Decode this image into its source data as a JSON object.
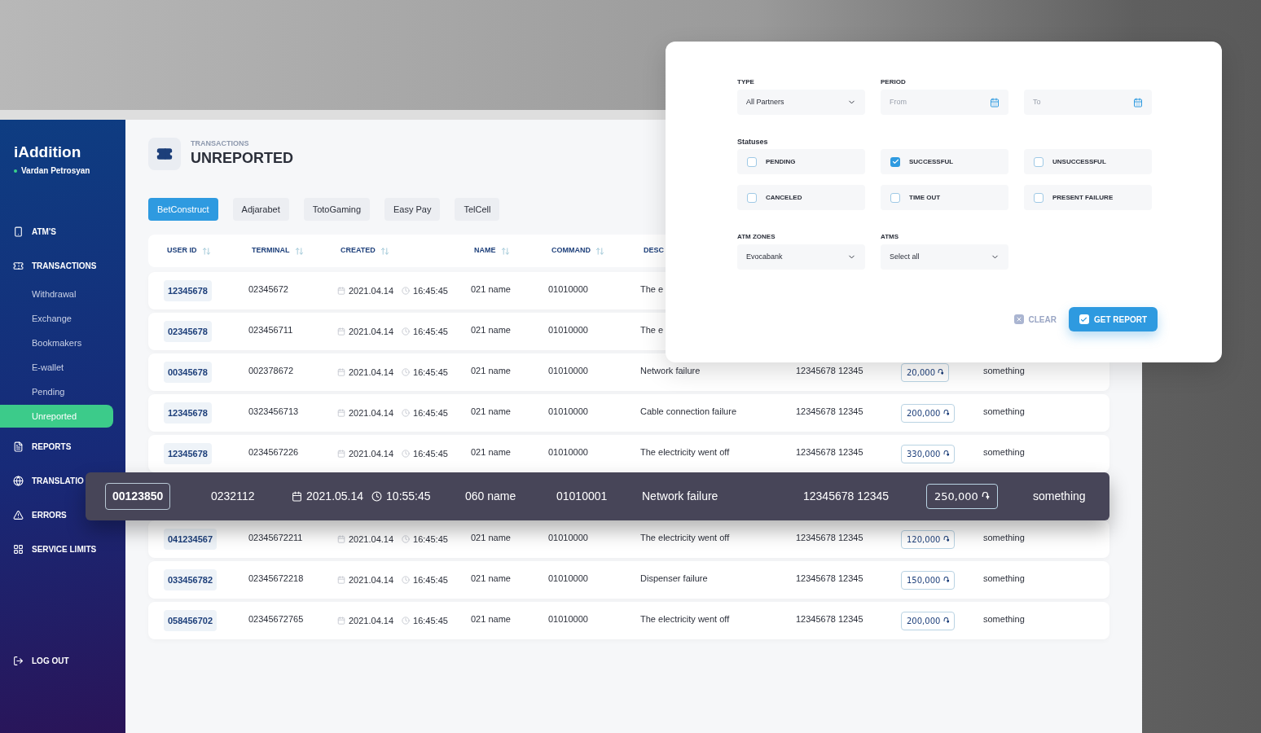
{
  "sidebar": {
    "brand": "iAddition",
    "user": "Vardan Petrosyan",
    "online": true,
    "nav": [
      {
        "label": "ATM'S"
      },
      {
        "label": "TRANSACTIONS",
        "children": [
          {
            "label": "Withdrawal",
            "selected": false
          },
          {
            "label": "Exchange",
            "selected": false
          },
          {
            "label": "Bookmakers",
            "selected": false
          },
          {
            "label": "E-wallet",
            "selected": false
          },
          {
            "label": "Pending",
            "selected": false
          },
          {
            "label": "Unreported",
            "selected": true
          }
        ]
      },
      {
        "label": "REPORTS"
      },
      {
        "label": "TRANSLATIO"
      },
      {
        "label": "ERRORS"
      },
      {
        "label": "SERVICE LIMITS"
      }
    ],
    "logout": "LOG OUT"
  },
  "header": {
    "section": "TRANSACTIONS",
    "title": "UNREPORTED"
  },
  "tabs": [
    {
      "label": "BetConstruct",
      "selected": true
    },
    {
      "label": "Adjarabet",
      "selected": false
    },
    {
      "label": "TotoGaming",
      "selected": false
    },
    {
      "label": "Easy Pay",
      "selected": false
    },
    {
      "label": "TelCell",
      "selected": false
    }
  ],
  "table": {
    "columns": [
      "USER ID",
      "TERMINAL",
      "CREATED",
      "NAME",
      "COMMAND",
      "DESC"
    ],
    "rows": [
      {
        "user_id": "12345678",
        "terminal": "02345672",
        "date": "2021.04.14",
        "time": "16:45:45",
        "name": "021 name",
        "command": "01010000",
        "description": "The e"
      },
      {
        "user_id": "02345678",
        "terminal": "023456711",
        "date": "2021.04.14",
        "time": "16:45:45",
        "name": "021 name",
        "command": "01010000",
        "description": "The e"
      },
      {
        "user_id": "00345678",
        "terminal": "002378672",
        "date": "2021.04.14",
        "time": "16:45:45",
        "name": "021 name",
        "command": "01010000",
        "description": "Network failure",
        "column_7": "12345678 12345",
        "amount": "20,000 ֏",
        "column_9": "something"
      },
      {
        "user_id": "12345678",
        "terminal": "0323456713",
        "date": "2021.04.14",
        "time": "16:45:45",
        "name": "021 name",
        "command": "01010000",
        "description": "Cable connection failure",
        "column_7": "12345678 12345",
        "amount": "200,000 ֏",
        "column_9": "something"
      },
      {
        "user_id": "12345678",
        "terminal": "0234567226",
        "date": "2021.04.14",
        "time": "16:45:45",
        "name": "021 name",
        "command": "01010000",
        "description": "The electricity went off",
        "column_7": "12345678 12345",
        "amount": "330,000 ֏",
        "column_9": "something"
      },
      {
        "user_id": "041234567",
        "terminal": "02345672211",
        "date": "2021.04.14",
        "time": "16:45:45",
        "name": "021 name",
        "command": "01010000",
        "description": "The electricity went off",
        "column_7": "12345678 12345",
        "amount": "120,000 ֏",
        "column_9": "something"
      },
      {
        "user_id": "033456782",
        "terminal": "02345672218",
        "date": "2021.04.14",
        "time": "16:45:45",
        "name": "021 name",
        "command": "01010000",
        "description": "Dispenser failure",
        "column_7": "12345678 12345",
        "amount": "150,000 ֏",
        "column_9": "something"
      },
      {
        "user_id": "058456702",
        "terminal": "02345672765",
        "date": "2021.04.14",
        "time": "16:45:45",
        "name": "021 name",
        "command": "01010000",
        "description": "The electricity went off",
        "column_7": "12345678 12345",
        "amount": "200,000 ֏",
        "column_9": "something"
      }
    ],
    "lifted_row": {
      "user_id": "00123850",
      "terminal": "0232112",
      "date": "2021.05.14",
      "time": "10:55:45",
      "name": "060 name",
      "command": "01010001",
      "description": "Network failure",
      "column_7": "12345678 12345",
      "amount": "250,000 ֏",
      "column_9": "something"
    }
  },
  "filter": {
    "type": {
      "label": "TYPE",
      "value": "All Partners"
    },
    "period": {
      "label": "PERIOD",
      "from_placeholder": "From",
      "to_placeholder": "To"
    },
    "statuses_label": "Statuses",
    "statuses": [
      {
        "label": "PENDING",
        "checked": false
      },
      {
        "label": "SUCCESSFUL",
        "checked": true
      },
      {
        "label": "UNSUCCESSFUL",
        "checked": false
      },
      {
        "label": "CANCELED",
        "checked": false
      },
      {
        "label": "TIME OUT",
        "checked": false
      },
      {
        "label": "PRESENT FAILURE",
        "checked": false
      }
    ],
    "atm_zones": {
      "label": "ATM ZONES",
      "value": "Evocabank"
    },
    "atms": {
      "label": "ATMS",
      "value": "Select all"
    },
    "clear": "CLEAR",
    "submit": "GET REPORT"
  }
}
